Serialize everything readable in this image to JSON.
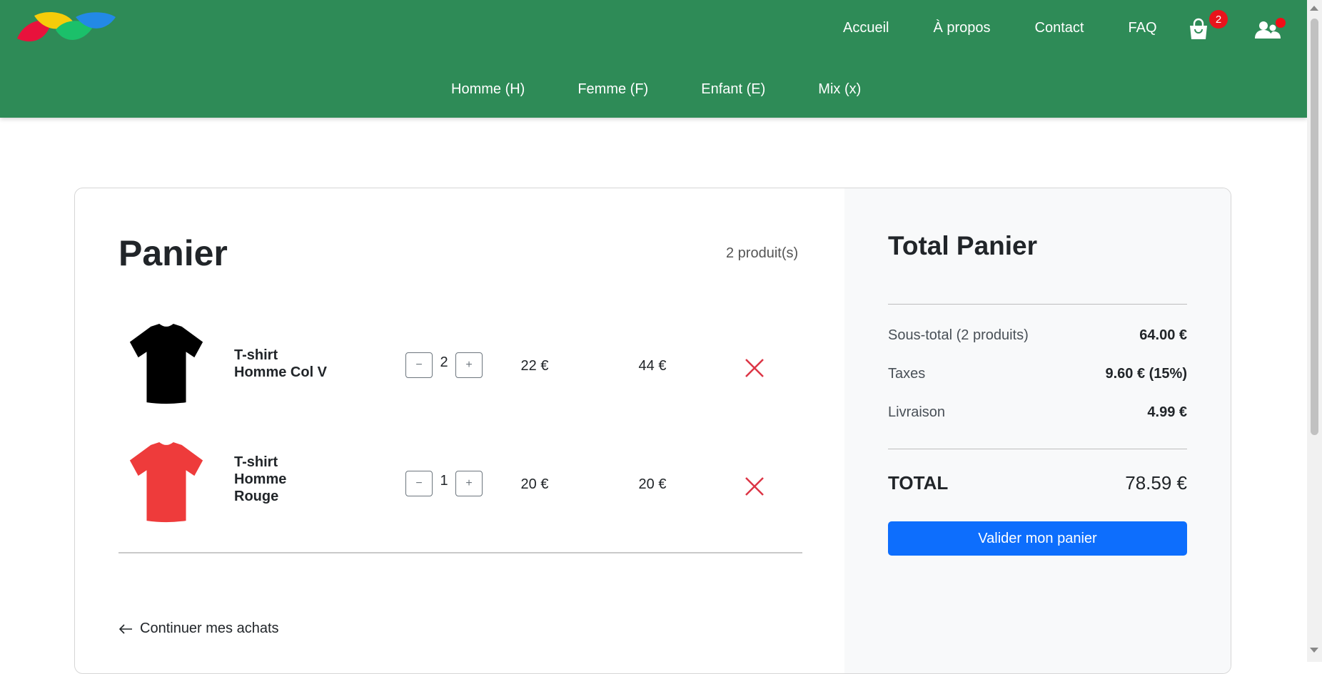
{
  "header": {
    "top_nav": [
      "Accueil",
      "À propos",
      "Contact",
      "FAQ"
    ],
    "cart_count": "2",
    "category_nav": [
      "Homme (H)",
      "Femme (F)",
      "Enfant (E)",
      "Mix (x)"
    ]
  },
  "cart": {
    "title": "Panier",
    "count_label": "2 produit(s)",
    "items": [
      {
        "name": "T-shirt Homme Col V",
        "color": "#000000",
        "quantity": "2",
        "unit_price": "22 €",
        "total": "44 €"
      },
      {
        "name": "T-shirt Homme Rouge",
        "color": "#ee3b3b",
        "quantity": "1",
        "unit_price": "20 €",
        "total": "20 €"
      }
    ],
    "qty_minus_label": "−",
    "qty_plus_label": "+",
    "continue_label": "Continuer mes achats"
  },
  "summary": {
    "title": "Total Panier",
    "subtotal_label": "Sous-total (2 produits)",
    "subtotal_value": "64.00 €",
    "taxes_label": "Taxes",
    "taxes_value": "9.60 € (15%)",
    "shipping_label": "Livraison",
    "shipping_value": "4.99 €",
    "total_label": "TOTAL",
    "total_value": "78.59 €",
    "validate_label": "Valider mon panier"
  },
  "colors": {
    "header_bg": "#2e8b57",
    "primary_button": "#0d6efd",
    "remove_icon": "#dc3545",
    "badge": "#e8141b"
  }
}
